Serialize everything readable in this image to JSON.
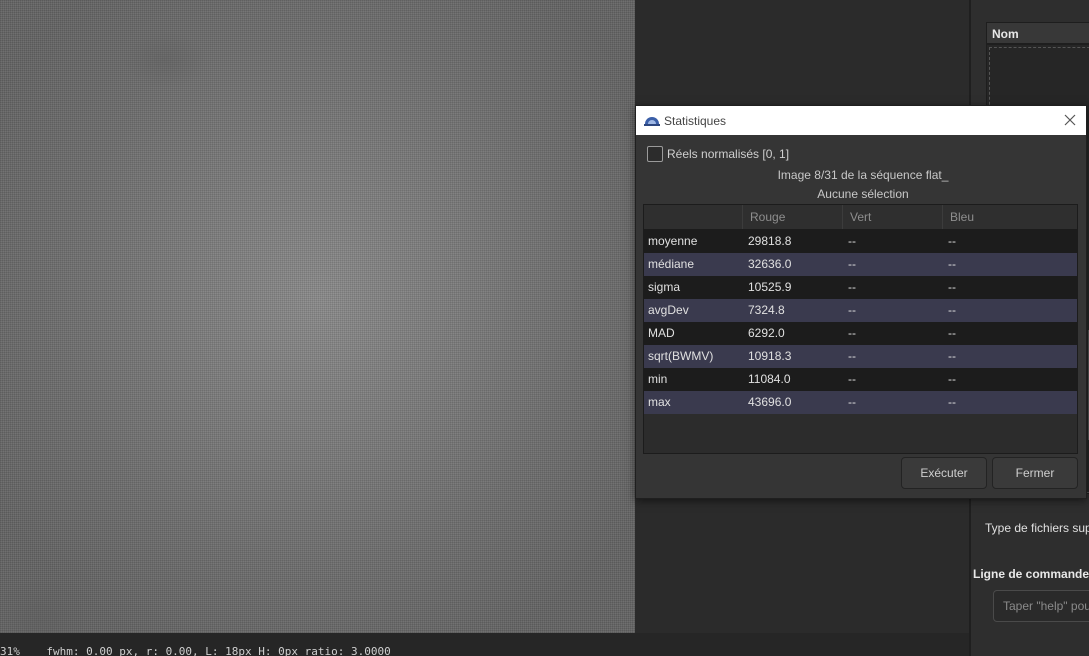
{
  "statusbar": {
    "text": "31%    fwhm: 0.00 px, r: 0.00, L: 18px H: 0px ratio: 3.0000"
  },
  "files_panel": {
    "header": "Nom",
    "filetype_label": "Type de fichiers supp"
  },
  "command": {
    "title": "Ligne de commande",
    "placeholder": "Taper \"help\" pou"
  },
  "dialog": {
    "title": "Statistiques",
    "checkbox_label": "Réels normalisés [0, 1]",
    "checkbox_checked": false,
    "image_info": "Image 8/31 de la séquence flat_",
    "selection_info": "Aucune sélection",
    "columns": [
      "",
      "Rouge",
      "Vert",
      "Bleu"
    ],
    "rows": [
      {
        "name": "moyenne",
        "rouge": "29818.8",
        "vert": "--",
        "bleu": "--"
      },
      {
        "name": "médiane",
        "rouge": "32636.0",
        "vert": "--",
        "bleu": "--"
      },
      {
        "name": "sigma",
        "rouge": "10525.9",
        "vert": "--",
        "bleu": "--"
      },
      {
        "name": "avgDev",
        "rouge": "7324.8",
        "vert": "--",
        "bleu": "--"
      },
      {
        "name": "MAD",
        "rouge": "6292.0",
        "vert": "--",
        "bleu": "--"
      },
      {
        "name": "sqrt(BWMV)",
        "rouge": "10918.3",
        "vert": "--",
        "bleu": "--"
      },
      {
        "name": "min",
        "rouge": "11084.0",
        "vert": "--",
        "bleu": "--"
      },
      {
        "name": "max",
        "rouge": "43696.0",
        "vert": "--",
        "bleu": "--"
      }
    ],
    "execute_label": "Exécuter",
    "close_label": "Fermer"
  },
  "icons": {
    "app": "siril-dome-icon",
    "close": "close-icon"
  },
  "colors": {
    "row_dark": "#1c1c1c",
    "row_light": "#3a3a4e",
    "titlebar": "#ffffff"
  }
}
